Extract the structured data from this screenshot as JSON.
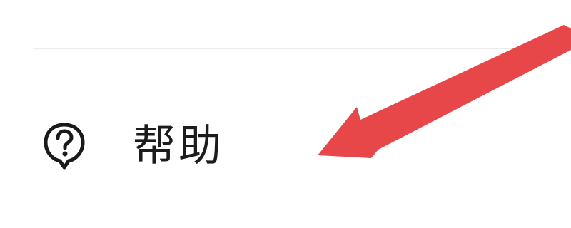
{
  "menu": {
    "help_label": "帮助",
    "help_icon": "help-question-bubble-icon"
  },
  "annotation": {
    "arrow_color": "#e8474a"
  }
}
